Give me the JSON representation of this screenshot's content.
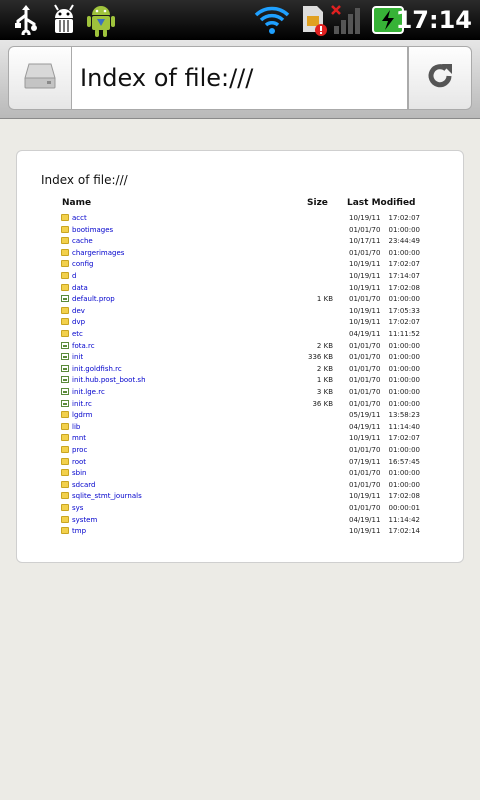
{
  "status_bar": {
    "time": "17:14",
    "icons": [
      "usb-icon",
      "debug-icon",
      "android-icon",
      "wifi-icon",
      "sim-icon",
      "signal-icon",
      "battery-icon"
    ]
  },
  "browser": {
    "url": "Index of file:///"
  },
  "page": {
    "title": "Index of file:///",
    "columns": {
      "name": "Name",
      "size": "Size",
      "modified": "Last Modified"
    },
    "entries": [
      {
        "name": "acct",
        "type": "folder",
        "size": "",
        "date": "10/19/11",
        "time": "17:02:07"
      },
      {
        "name": "bootimages",
        "type": "folder",
        "size": "",
        "date": "01/01/70",
        "time": "01:00:00"
      },
      {
        "name": "cache",
        "type": "folder",
        "size": "",
        "date": "10/17/11",
        "time": "23:44:49"
      },
      {
        "name": "chargerimages",
        "type": "folder",
        "size": "",
        "date": "01/01/70",
        "time": "01:00:00"
      },
      {
        "name": "config",
        "type": "folder",
        "size": "",
        "date": "10/19/11",
        "time": "17:02:07"
      },
      {
        "name": "d",
        "type": "folder",
        "size": "",
        "date": "10/19/11",
        "time": "17:14:07"
      },
      {
        "name": "data",
        "type": "folder",
        "size": "",
        "date": "10/19/11",
        "time": "17:02:08"
      },
      {
        "name": "default.prop",
        "type": "file",
        "size": "1 KB",
        "date": "01/01/70",
        "time": "01:00:00"
      },
      {
        "name": "dev",
        "type": "folder",
        "size": "",
        "date": "10/19/11",
        "time": "17:05:33"
      },
      {
        "name": "dvp",
        "type": "folder",
        "size": "",
        "date": "10/19/11",
        "time": "17:02:07"
      },
      {
        "name": "etc",
        "type": "folder",
        "size": "",
        "date": "04/19/11",
        "time": "11:11:52"
      },
      {
        "name": "fota.rc",
        "type": "file",
        "size": "2 KB",
        "date": "01/01/70",
        "time": "01:00:00"
      },
      {
        "name": "init",
        "type": "file",
        "size": "336 KB",
        "date": "01/01/70",
        "time": "01:00:00"
      },
      {
        "name": "init.goldfish.rc",
        "type": "file",
        "size": "2 KB",
        "date": "01/01/70",
        "time": "01:00:00"
      },
      {
        "name": "init.hub.post_boot.sh",
        "type": "file",
        "size": "1 KB",
        "date": "01/01/70",
        "time": "01:00:00"
      },
      {
        "name": "init.lge.rc",
        "type": "file",
        "size": "3 KB",
        "date": "01/01/70",
        "time": "01:00:00"
      },
      {
        "name": "init.rc",
        "type": "file",
        "size": "36 KB",
        "date": "01/01/70",
        "time": "01:00:00"
      },
      {
        "name": "lgdrm",
        "type": "folder",
        "size": "",
        "date": "05/19/11",
        "time": "13:58:23"
      },
      {
        "name": "lib",
        "type": "folder",
        "size": "",
        "date": "04/19/11",
        "time": "11:14:40"
      },
      {
        "name": "mnt",
        "type": "folder",
        "size": "",
        "date": "10/19/11",
        "time": "17:02:07"
      },
      {
        "name": "proc",
        "type": "folder",
        "size": "",
        "date": "01/01/70",
        "time": "01:00:00"
      },
      {
        "name": "root",
        "type": "folder",
        "size": "",
        "date": "07/19/11",
        "time": "16:57:45"
      },
      {
        "name": "sbin",
        "type": "folder",
        "size": "",
        "date": "01/01/70",
        "time": "01:00:00"
      },
      {
        "name": "sdcard",
        "type": "folder",
        "size": "",
        "date": "01/01/70",
        "time": "01:00:00"
      },
      {
        "name": "sqlite_stmt_journals",
        "type": "folder",
        "size": "",
        "date": "10/19/11",
        "time": "17:02:08"
      },
      {
        "name": "sys",
        "type": "folder",
        "size": "",
        "date": "01/01/70",
        "time": "00:00:01"
      },
      {
        "name": "system",
        "type": "folder",
        "size": "",
        "date": "04/19/11",
        "time": "11:14:42"
      },
      {
        "name": "tmp",
        "type": "folder",
        "size": "",
        "date": "10/19/11",
        "time": "17:02:14"
      }
    ]
  },
  "colors": {
    "link": "#0000cc",
    "folder": "#f2d04c",
    "battery": "#37b337"
  }
}
